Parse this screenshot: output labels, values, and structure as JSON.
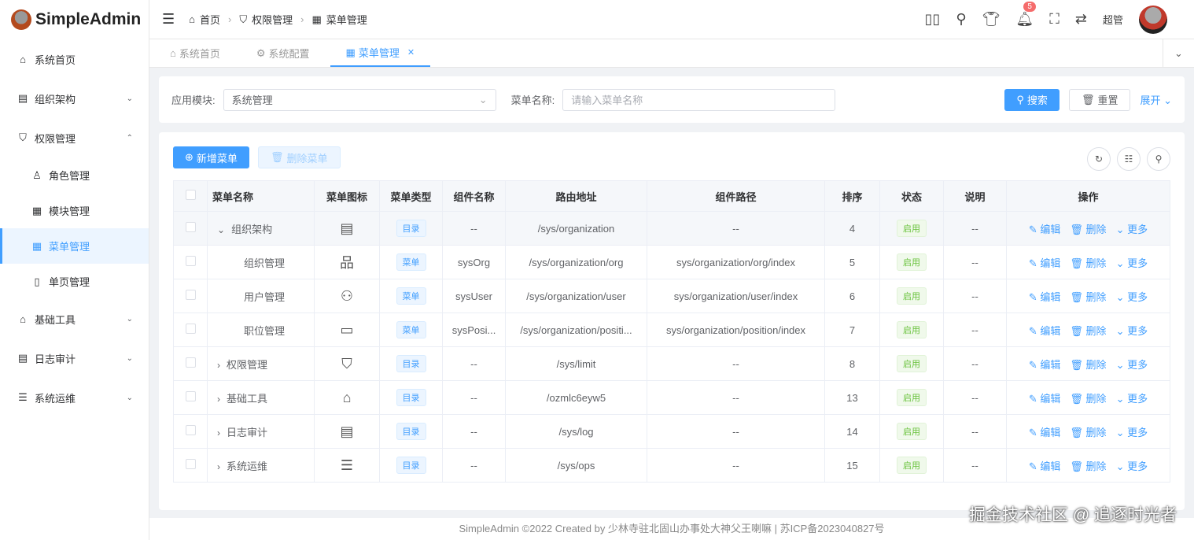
{
  "app": {
    "title": "SimpleAdmin"
  },
  "sidebar": {
    "items": [
      {
        "label": "系统首页",
        "icon": "home-icon",
        "glyph": "⌂",
        "chevron": ""
      },
      {
        "label": "组织架构",
        "icon": "building-icon",
        "glyph": "▤",
        "chevron": "⌄"
      },
      {
        "label": "权限管理",
        "icon": "shield-icon",
        "glyph": "⛉",
        "chevron": "⌃"
      },
      {
        "label": "角色管理",
        "icon": "user-icon",
        "glyph": "♙",
        "sub": true
      },
      {
        "label": "模块管理",
        "icon": "grid-icon",
        "glyph": "▦",
        "sub": true
      },
      {
        "label": "菜单管理",
        "icon": "menu-grid-icon",
        "glyph": "▦",
        "sub": true,
        "active": true
      },
      {
        "label": "单页管理",
        "icon": "book-icon",
        "glyph": "▯",
        "sub": true
      },
      {
        "label": "基础工具",
        "icon": "home-filled-icon",
        "glyph": "⌂",
        "chevron": "⌄"
      },
      {
        "label": "日志审计",
        "icon": "log-icon",
        "glyph": "▤",
        "chevron": "⌄"
      },
      {
        "label": "系统运维",
        "icon": "server-icon",
        "glyph": "☰",
        "chevron": "⌄"
      }
    ]
  },
  "header": {
    "breadcrumb": [
      "首页",
      "权限管理",
      "菜单管理"
    ],
    "notification_count": "5",
    "user": "超管"
  },
  "tabs": [
    {
      "label": "系统首页",
      "glyph": "⌂"
    },
    {
      "label": "系统配置",
      "glyph": "⚙"
    },
    {
      "label": "菜单管理",
      "glyph": "▦",
      "active": true
    }
  ],
  "search": {
    "module_label": "应用模块:",
    "module_value": "系统管理",
    "name_label": "菜单名称:",
    "name_placeholder": "请输入菜单名称",
    "search_btn": "搜索",
    "reset_btn": "重置",
    "expand_btn": "展开"
  },
  "toolbar": {
    "add": "新增菜单",
    "delete": "删除菜单"
  },
  "table": {
    "columns": [
      "菜单名称",
      "菜单图标",
      "菜单类型",
      "组件名称",
      "路由地址",
      "组件路径",
      "排序",
      "状态",
      "说明",
      "操作"
    ],
    "actions": {
      "edit": "编辑",
      "delete": "删除",
      "more": "更多"
    },
    "rows": [
      {
        "name": "组织架构",
        "expand": "⌄",
        "level": 0,
        "icon": "▤",
        "icon_name": "building-icon",
        "type": "目录",
        "comp": "--",
        "route": "/sys/organization",
        "path": "--",
        "sort": "4",
        "status": "启用",
        "desc": "--"
      },
      {
        "name": "组织管理",
        "expand": "",
        "level": 1,
        "icon": "品",
        "icon_name": "org-tree-icon",
        "type": "菜单",
        "comp": "sysOrg",
        "route": "/sys/organization/org",
        "path": "sys/organization/org/index",
        "sort": "5",
        "status": "启用",
        "desc": "--"
      },
      {
        "name": "用户管理",
        "expand": "",
        "level": 1,
        "icon": "⚇",
        "icon_name": "users-icon",
        "type": "菜单",
        "comp": "sysUser",
        "route": "/sys/organization/user",
        "path": "sys/organization/user/index",
        "sort": "6",
        "status": "启用",
        "desc": "--"
      },
      {
        "name": "职位管理",
        "expand": "",
        "level": 1,
        "icon": "▭",
        "icon_name": "id-card-icon",
        "type": "菜单",
        "comp": "sysPosi...",
        "route": "/sys/organization/positi...",
        "path": "sys/organization/position/index",
        "sort": "7",
        "status": "启用",
        "desc": "--"
      },
      {
        "name": "权限管理",
        "expand": "›",
        "level": 0,
        "icon": "⛉",
        "icon_name": "shield-icon",
        "type": "目录",
        "comp": "--",
        "route": "/sys/limit",
        "path": "--",
        "sort": "8",
        "status": "启用",
        "desc": "--"
      },
      {
        "name": "基础工具",
        "expand": "›",
        "level": 0,
        "icon": "⌂",
        "icon_name": "home-filled-icon",
        "type": "目录",
        "comp": "--",
        "route": "/ozmlc6eyw5",
        "path": "--",
        "sort": "13",
        "status": "启用",
        "desc": "--"
      },
      {
        "name": "日志审计",
        "expand": "›",
        "level": 0,
        "icon": "▤",
        "icon_name": "log-icon",
        "type": "目录",
        "comp": "--",
        "route": "/sys/log",
        "path": "--",
        "sort": "14",
        "status": "启用",
        "desc": "--"
      },
      {
        "name": "系统运维",
        "expand": "›",
        "level": 0,
        "icon": "☰",
        "icon_name": "server-icon",
        "type": "目录",
        "comp": "--",
        "route": "/sys/ops",
        "path": "--",
        "sort": "15",
        "status": "启用",
        "desc": "--"
      }
    ]
  },
  "footer": "SimpleAdmin ©2022 Created by 少林寺驻北固山办事处大神父王喇嘛 | 苏ICP备2023040827号",
  "watermark": "掘金技术社区 @ 追逐时光者"
}
